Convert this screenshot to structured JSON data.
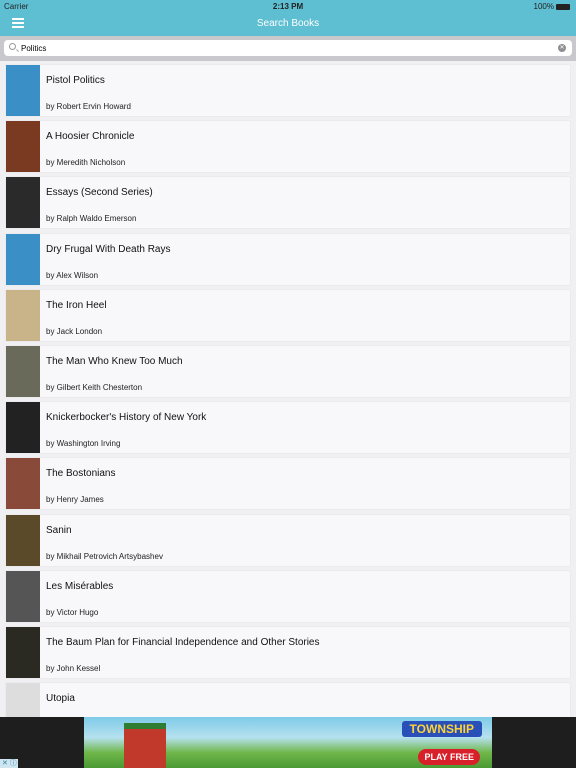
{
  "status": {
    "carrier": "Carrier",
    "time": "2:13 PM",
    "battery": "100%"
  },
  "header": {
    "title": "Search Books"
  },
  "search": {
    "value": "Politics"
  },
  "books": [
    {
      "title": "Pistol Politics",
      "author": "by Robert Ervin Howard",
      "cover": "#3a8fc7"
    },
    {
      "title": "A Hoosier Chronicle",
      "author": "by Meredith Nicholson",
      "cover": "#7a3a22"
    },
    {
      "title": "Essays (Second Series)",
      "author": "by Ralph Waldo Emerson",
      "cover": "#2a2a2a"
    },
    {
      "title": "Dry Frugal With Death Rays",
      "author": "by Alex Wilson",
      "cover": "#3a8fc7"
    },
    {
      "title": "The Iron Heel",
      "author": "by Jack London",
      "cover": "#c9b48a"
    },
    {
      "title": "The Man Who Knew Too Much",
      "author": "by Gilbert Keith Chesterton",
      "cover": "#6a6a5a"
    },
    {
      "title": "Knickerbocker's History of New York",
      "author": "by Washington Irving",
      "cover": "#222222"
    },
    {
      "title": "The Bostonians",
      "author": "by Henry James",
      "cover": "#8a4a3a"
    },
    {
      "title": "Sanin",
      "author": "by Mikhail Petrovich Artsybashev",
      "cover": "#5a4a2a"
    },
    {
      "title": "Les Misérables",
      "author": "by Victor Hugo",
      "cover": "#555555"
    },
    {
      "title": "The Baum Plan for Financial Independence and Other Stories",
      "author": "by John Kessel",
      "cover": "#2a2a22"
    },
    {
      "title": "Utopia",
      "author": "",
      "cover": "#dddddd"
    }
  ],
  "ad": {
    "brand": "TOWNSHIP",
    "cta": "PLAY FREE"
  }
}
